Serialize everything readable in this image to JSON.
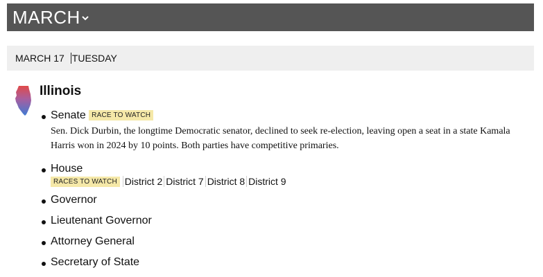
{
  "header": {
    "month": "MARCH",
    "chevron_icon": "chevron-down-icon"
  },
  "date_bar": {
    "date": "MARCH 17",
    "weekday": "TUESDAY"
  },
  "state": {
    "name": "Illinois",
    "icon": "illinois-state-map-icon",
    "colors": {
      "top": "#e04a4a",
      "bottom": "#3f7bd4"
    }
  },
  "races": [
    {
      "name": "Senate",
      "badge": "RACE TO WATCH",
      "description": "Sen. Dick Durbin, the longtime Democratic senator, declined to seek re-election, leaving open a seat in a state Kamala Harris won in 2024 by 10 points. Both parties have competitive primaries."
    },
    {
      "name": "House",
      "badge": "RACES TO WATCH",
      "districts": [
        "District 2",
        "District 7",
        "District 8",
        "District 9"
      ]
    },
    {
      "name": "Governor"
    },
    {
      "name": "Lieutenant Governor"
    },
    {
      "name": "Attorney General"
    },
    {
      "name": "Secretary of State"
    }
  ],
  "colors": {
    "header_bg": "#555555",
    "date_bg": "#efefef",
    "badge_bg": "#f5e8a8"
  }
}
